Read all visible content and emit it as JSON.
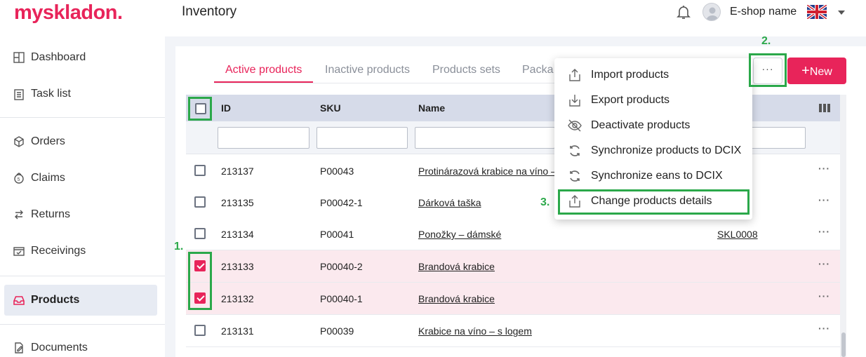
{
  "header": {
    "logo_main": "myskladon",
    "logo_dot": ".",
    "title": "Inventory",
    "shop_name": "E-shop name",
    "icons": {
      "notifications": "bell-icon",
      "user": "avatar-icon",
      "language": "uk-flag-icon",
      "expand": "chevron-down-icon"
    }
  },
  "sidebar": {
    "items": [
      {
        "label": "Dashboard",
        "icon": "dashboard-icon"
      },
      {
        "label": "Task list",
        "icon": "clipboard-icon"
      },
      {
        "label": "Orders",
        "icon": "cube-icon"
      },
      {
        "label": "Claims",
        "icon": "claims-icon"
      },
      {
        "label": "Returns",
        "icon": "returns-icon"
      },
      {
        "label": "Receivings",
        "icon": "receivings-icon"
      },
      {
        "label": "Products",
        "icon": "inbox-icon",
        "active": true
      },
      {
        "label": "Documents",
        "icon": "document-edit-icon"
      }
    ]
  },
  "tabs": [
    {
      "label": "Active products",
      "active": true
    },
    {
      "label": "Inactive products"
    },
    {
      "label": "Products sets"
    },
    {
      "label": "Packa"
    }
  ],
  "toolbar": {
    "more_label": "···",
    "new_label": "New",
    "new_icon": "plus-icon"
  },
  "table": {
    "columns": [
      "ID",
      "SKU",
      "Name"
    ],
    "rows": [
      {
        "id": "213137",
        "sku": "P00043",
        "name": "Protinárazová krabice na víno –",
        "extra": "",
        "checked": false,
        "menu": "···"
      },
      {
        "id": "213135",
        "sku": "P00042-1",
        "name": "Dárková taška",
        "extra": "",
        "checked": false,
        "menu": "···"
      },
      {
        "id": "213134",
        "sku": "P00041",
        "name": "Ponožky – dámské",
        "extra": "SKL0008",
        "checked": false,
        "menu": "···"
      },
      {
        "id": "213133",
        "sku": "P00040-2",
        "name": "Brandová krabice",
        "extra": "",
        "checked": true,
        "menu": "···"
      },
      {
        "id": "213132",
        "sku": "P00040-1",
        "name": "Brandová krabice",
        "extra": "",
        "checked": true,
        "menu": "···"
      },
      {
        "id": "213131",
        "sku": "P00039",
        "name": "Krabice na víno – s logem",
        "extra": "",
        "checked": false,
        "menu": "···"
      }
    ]
  },
  "dropdown": {
    "items": [
      {
        "label": "Import products",
        "icon": "upload-icon"
      },
      {
        "label": "Export products",
        "icon": "download-icon"
      },
      {
        "label": "Deactivate products",
        "icon": "eye-off-icon"
      },
      {
        "label": "Synchronize products to DCIX",
        "icon": "sync-icon"
      },
      {
        "label": "Synchronize eans to DCIX",
        "icon": "sync-icon"
      },
      {
        "label": "Change products details",
        "icon": "upload-icon"
      }
    ]
  },
  "annotations": {
    "step1": "1.",
    "step2": "2.",
    "step3": "3.",
    "color": "#2ba84a"
  },
  "colors": {
    "accent": "#e8245a",
    "header_row": "#d6dbe9",
    "selected_row": "#fbe9ee"
  }
}
